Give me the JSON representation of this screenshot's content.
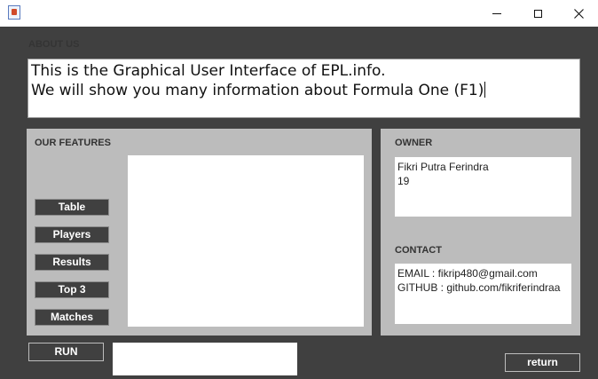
{
  "window": {
    "icon": "java-app-icon",
    "controls": {
      "minimize": "minimize-icon",
      "maximize": "maximize-icon",
      "close": "close-icon"
    }
  },
  "about": {
    "label": "ABOUT US",
    "lines": [
      "This is the Graphical User Interface of EPL.info.",
      "We will show you many information about Formula One (F1)"
    ]
  },
  "features": {
    "label": "OUR FEATURES",
    "buttons": [
      "Table",
      "Players",
      "Results",
      "Top 3",
      "Matches"
    ]
  },
  "owner": {
    "label": "OWNER",
    "lines": [
      "Fikri Putra Ferindra",
      "19"
    ]
  },
  "contact": {
    "label": "CONTACT",
    "lines": [
      "EMAIL  : fikrip480@gmail.com",
      "GITHUB : github.com/fikriferindraa"
    ]
  },
  "actions": {
    "run": "RUN",
    "return": "return"
  },
  "colors": {
    "background": "#404040",
    "panel": "#bcbcbc",
    "button": "#404040",
    "text_field": "#ffffff"
  }
}
